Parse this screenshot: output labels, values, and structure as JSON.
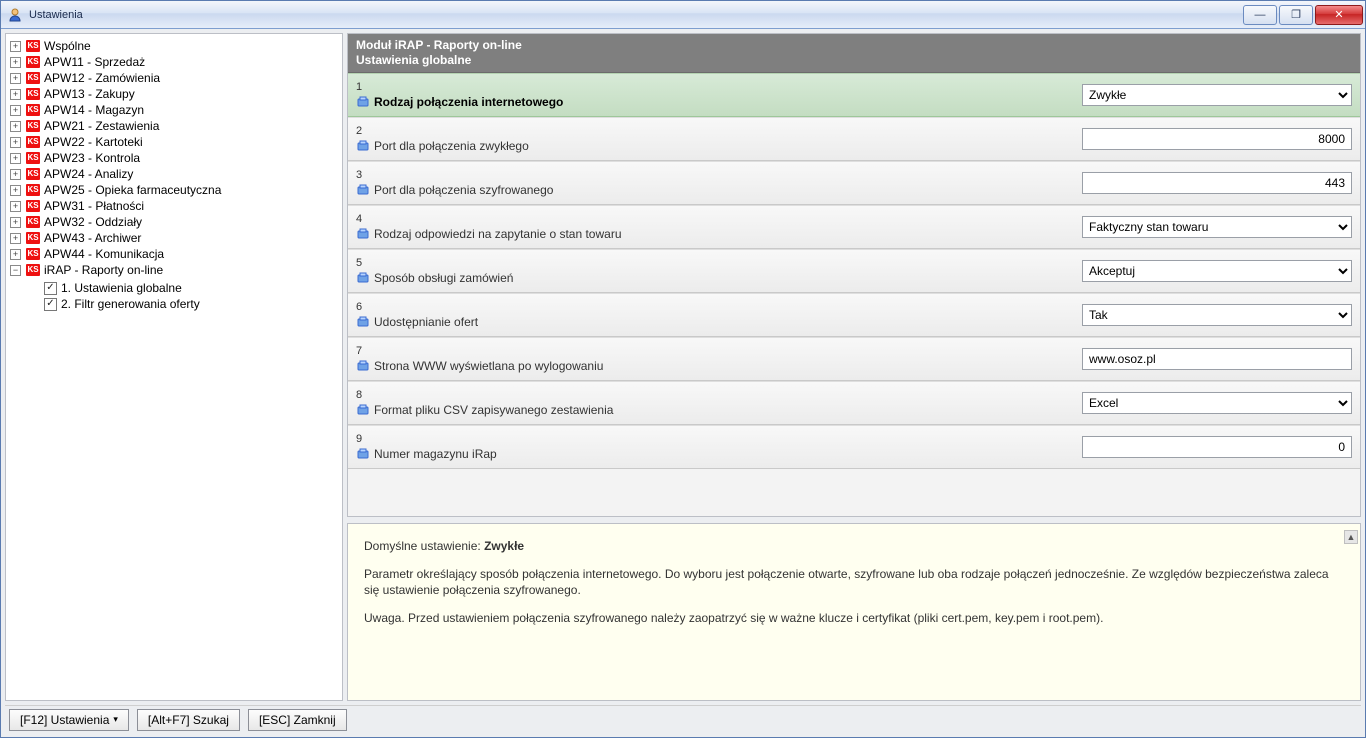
{
  "window": {
    "title": "Ustawienia"
  },
  "tree": {
    "modules": [
      "Wspólne",
      "APW11 - Sprzedaż",
      "APW12 - Zamówienia",
      "APW13 - Zakupy",
      "APW14 - Magazyn",
      "APW21 - Zestawienia",
      "APW22 - Kartoteki",
      "APW23 - Kontrola",
      "APW24 - Analizy",
      "APW25 - Opieka farmaceutyczna",
      "APW31 - Płatności",
      "APW32 - Oddziały",
      "APW43 - Archiwer",
      "APW44 - Komunikacja"
    ],
    "expanded_module": "iRAP - Raporty on-line",
    "children": [
      "1. Ustawienia globalne",
      "2. Filtr generowania oferty"
    ],
    "ks_badge": "KS"
  },
  "header": {
    "line1": "Moduł iRAP - Raporty on-line",
    "line2": "Ustawienia globalne"
  },
  "settings": [
    {
      "num": "1",
      "label": "Rodzaj połączenia internetowego",
      "type": "select",
      "value": "Zwykłe",
      "selected": true
    },
    {
      "num": "2",
      "label": "Port dla połączenia zwykłego",
      "type": "text-number",
      "value": "8000"
    },
    {
      "num": "3",
      "label": "Port dla połączenia szyfrowanego",
      "type": "text-number",
      "value": "443"
    },
    {
      "num": "4",
      "label": "Rodzaj odpowiedzi na zapytanie o stan towaru",
      "type": "select",
      "value": "Faktyczny stan towaru"
    },
    {
      "num": "5",
      "label": "Sposób obsługi zamówień",
      "type": "select",
      "value": "Akceptuj"
    },
    {
      "num": "6",
      "label": "Udostępnianie ofert",
      "type": "select",
      "value": "Tak"
    },
    {
      "num": "7",
      "label": "Strona WWW wyświetlana po wylogowaniu",
      "type": "text",
      "value": "www.osoz.pl"
    },
    {
      "num": "8",
      "label": "Format pliku CSV zapisywanego zestawienia",
      "type": "select",
      "value": "Excel"
    },
    {
      "num": "9",
      "label": "Numer magazynu iRap",
      "type": "text-number",
      "value": "0"
    }
  ],
  "help": {
    "default_label": "Domyślne ustawienie: ",
    "default_value": "Zwykłe",
    "para1": "Parametr określający sposób połączenia internetowego. Do wyboru jest połączenie otwarte, szyfrowane lub oba rodzaje połączeń jednocześnie. Ze względów bezpieczeństwa zaleca się ustawienie połączenia szyfrowanego.",
    "para2": "Uwaga. Przed ustawieniem połączenia szyfrowanego należy zaopatrzyć się w ważne klucze i certyfikat (pliki cert.pem, key.pem i root.pem)."
  },
  "footer": {
    "btn_settings": "[F12] Ustawienia",
    "btn_search": "[Alt+F7] Szukaj",
    "btn_close": "[ESC] Zamknij"
  },
  "glyphs": {
    "plus": "+",
    "minus": "−",
    "check": "✓",
    "caret": "▾",
    "min": "—",
    "max": "❐",
    "x": "✕",
    "up": "▲"
  }
}
